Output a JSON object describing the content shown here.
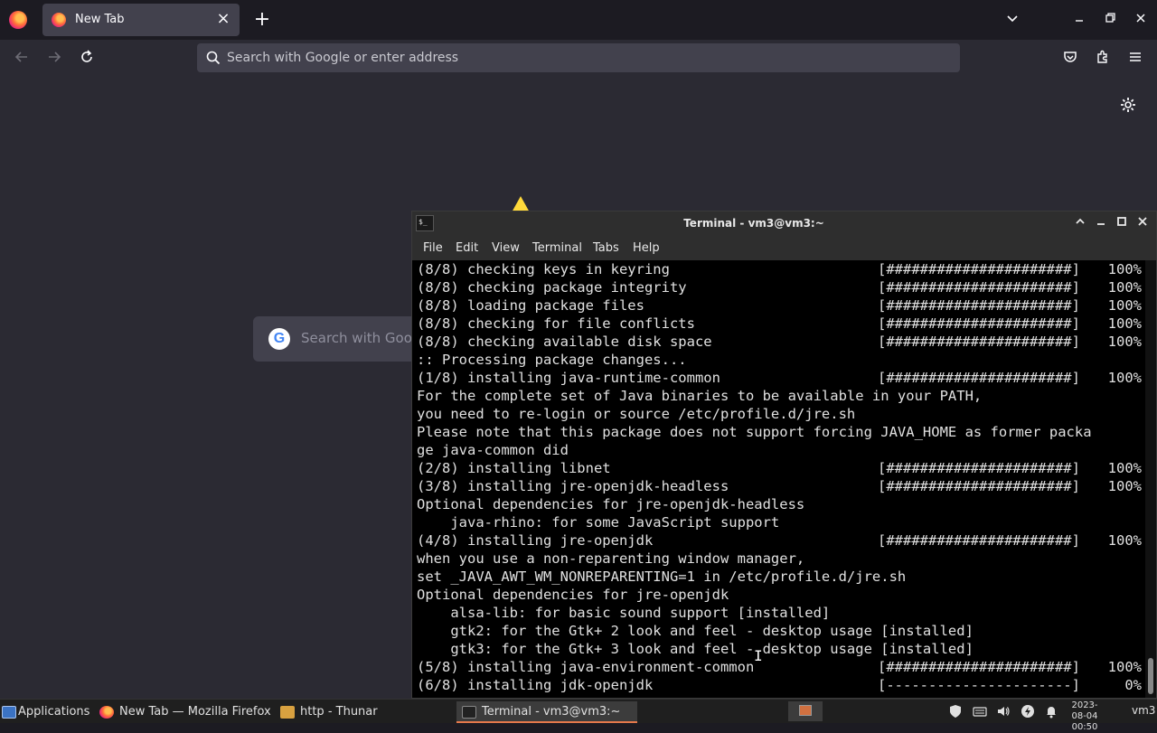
{
  "browser": {
    "tab": {
      "title": "New Tab"
    },
    "urlbar": {
      "placeholder": "Search with Google or enter address"
    },
    "newtab": {
      "google_search_text": "Search with Googl"
    }
  },
  "terminal": {
    "title": "Terminal - vm3@vm3:~",
    "menu": [
      "File",
      "Edit",
      "View",
      "Terminal",
      "Tabs",
      "Help"
    ],
    "lines": [
      {
        "text": "(8/8) checking keys in keyring",
        "progress": "[######################]",
        "percent": "100%"
      },
      {
        "text": "(8/8) checking package integrity",
        "progress": "[######################]",
        "percent": "100%"
      },
      {
        "text": "(8/8) loading package files",
        "progress": "[######################]",
        "percent": "100%"
      },
      {
        "text": "(8/8) checking for file conflicts",
        "progress": "[######################]",
        "percent": "100%"
      },
      {
        "text": "(8/8) checking available disk space",
        "progress": "[######################]",
        "percent": "100%"
      },
      {
        "text": ":: Processing package changes...",
        "progress": "",
        "percent": ""
      },
      {
        "text": "(1/8) installing java-runtime-common",
        "progress": "[######################]",
        "percent": "100%"
      },
      {
        "text": "For the complete set of Java binaries to be available in your PATH,",
        "progress": "",
        "percent": ""
      },
      {
        "text": "you need to re-login or source /etc/profile.d/jre.sh",
        "progress": "",
        "percent": ""
      },
      {
        "text": "Please note that this package does not support forcing JAVA_HOME as former packa",
        "progress": "",
        "percent": ""
      },
      {
        "text": "ge java-common did",
        "progress": "",
        "percent": ""
      },
      {
        "text": "(2/8) installing libnet",
        "progress": "[######################]",
        "percent": "100%"
      },
      {
        "text": "(3/8) installing jre-openjdk-headless",
        "progress": "[######################]",
        "percent": "100%"
      },
      {
        "text": "Optional dependencies for jre-openjdk-headless",
        "progress": "",
        "percent": ""
      },
      {
        "text": "    java-rhino: for some JavaScript support",
        "progress": "",
        "percent": ""
      },
      {
        "text": "(4/8) installing jre-openjdk",
        "progress": "[######################]",
        "percent": "100%"
      },
      {
        "text": "when you use a non-reparenting window manager,",
        "progress": "",
        "percent": ""
      },
      {
        "text": "set _JAVA_AWT_WM_NONREPARENTING=1 in /etc/profile.d/jre.sh",
        "progress": "",
        "percent": ""
      },
      {
        "text": "Optional dependencies for jre-openjdk",
        "progress": "",
        "percent": ""
      },
      {
        "text": "    alsa-lib: for basic sound support [installed]",
        "progress": "",
        "percent": ""
      },
      {
        "text": "    gtk2: for the Gtk+ 2 look and feel - desktop usage [installed]",
        "progress": "",
        "percent": ""
      },
      {
        "text": "    gtk3: for the Gtk+ 3 look and feel - desktop usage [installed]",
        "progress": "",
        "percent": ""
      },
      {
        "text": "(5/8) installing java-environment-common",
        "progress": "[######################]",
        "percent": "100%"
      },
      {
        "text": "(6/8) installing jdk-openjdk",
        "progress": "[----------------------]",
        "percent": "0%"
      }
    ]
  },
  "taskbar": {
    "applications_label": "Applications",
    "firefox_label": "New Tab — Mozilla Firefox",
    "thunar_label": "http - Thunar",
    "terminal_label": "Terminal - vm3@vm3:~",
    "clock_date": "2023-08-04",
    "clock_time": "00:50",
    "user": "vm3"
  },
  "colors": {
    "terminal_bg": "#000000",
    "browser_bg": "#2b2a33",
    "taskbar_active_accent": "#e5794b"
  }
}
